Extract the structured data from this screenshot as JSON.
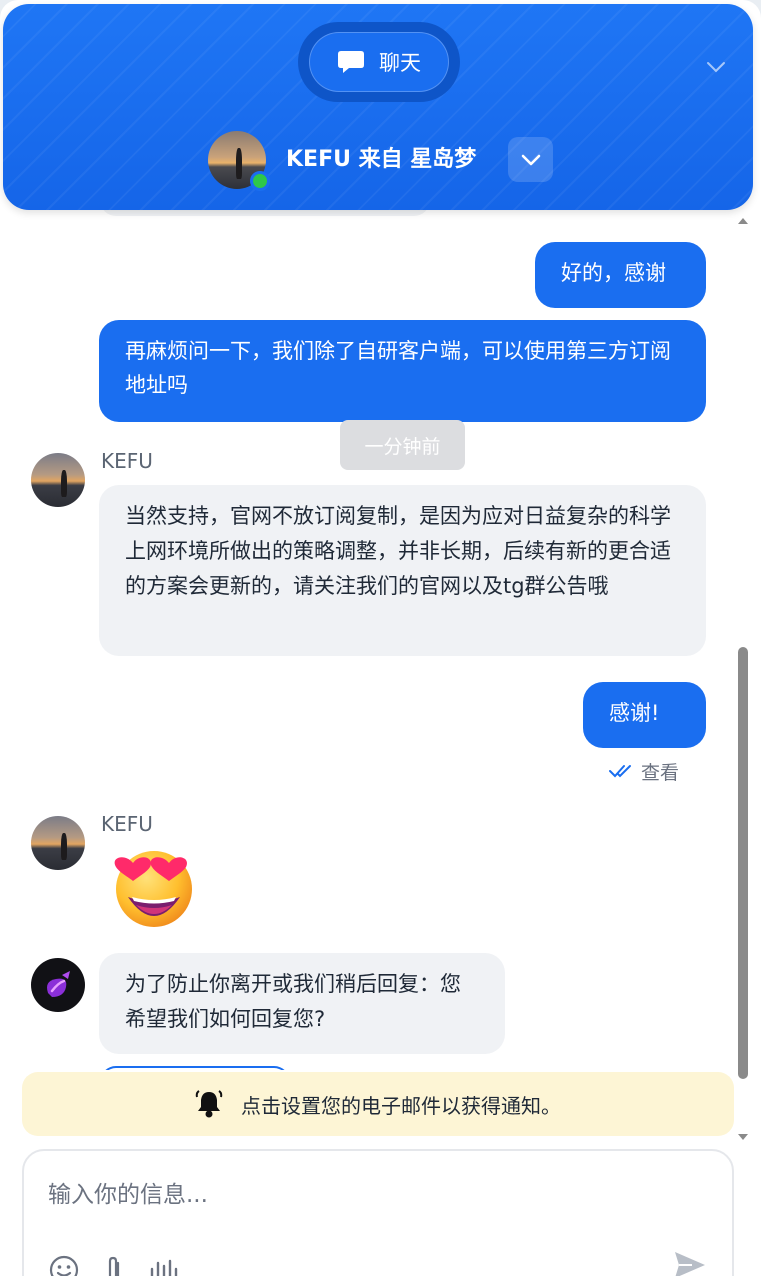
{
  "header": {
    "tab_label": "聊天",
    "agent_title": "KEFU 来自 星岛梦"
  },
  "messages": {
    "out_1": "好的，感谢",
    "out_2": "再麻烦问一下，我们除了自研客户端，可以使用第三方订阅地址吗",
    "timestamp": "一分钟前",
    "in_1_sender": "KEFU",
    "in_1_text": "当然支持，官网不放订阅复制，是因为应对日益复杂的科学上网环境所做出的策略调整，并非长期，后续有新的更合适的方案会更新的，请关注我们的官网以及tg群公告哦",
    "out_3": "感谢!",
    "seen_label": "查看",
    "in_2_sender": "KEFU",
    "in_2_emoji": "heart-eyes-emoji",
    "bot_text": "为了防止你离开或我们稍后回复：您希望我们如何回复您?"
  },
  "notice": {
    "text": "点击设置您的电子邮件以获得通知。"
  },
  "composer": {
    "placeholder": "输入你的信息..."
  },
  "colors": {
    "brand": "#1a6ef0",
    "online": "#2ec84a",
    "notice_bg": "#fdf5d5"
  },
  "icons": [
    "chat-bubble-icon",
    "chevron-down-icon",
    "double-check-icon",
    "bell-icon",
    "emoji-icon",
    "paperclip-icon",
    "voice-icon",
    "send-icon"
  ]
}
